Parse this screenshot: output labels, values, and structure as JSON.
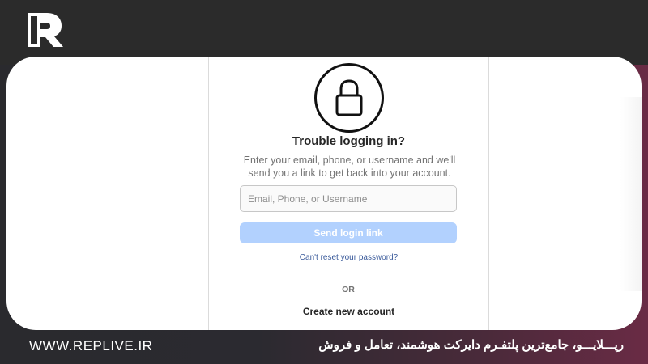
{
  "brand": {
    "logo_icon": "replive-logo-icon",
    "website": "WWW.REPLIVE.IR",
    "tagline": "رپـــلایـــو، جامع‌ترین پلتفـرم دایرکت هوشمند، تعامل و فروش",
    "accent_color": "#6a2b45"
  },
  "reset": {
    "icon": "lock-icon",
    "title": "Trouble logging in?",
    "description": "Enter your email, phone, or username and we'll send you a link to get back into your account.",
    "input_placeholder": "Email, Phone, or Username",
    "input_value": "",
    "send_button": "Send login link",
    "send_button_color": "#b2d1fe",
    "reset_link": "Can't reset your password?",
    "divider_text": "OR",
    "create_account": "Create new account"
  }
}
